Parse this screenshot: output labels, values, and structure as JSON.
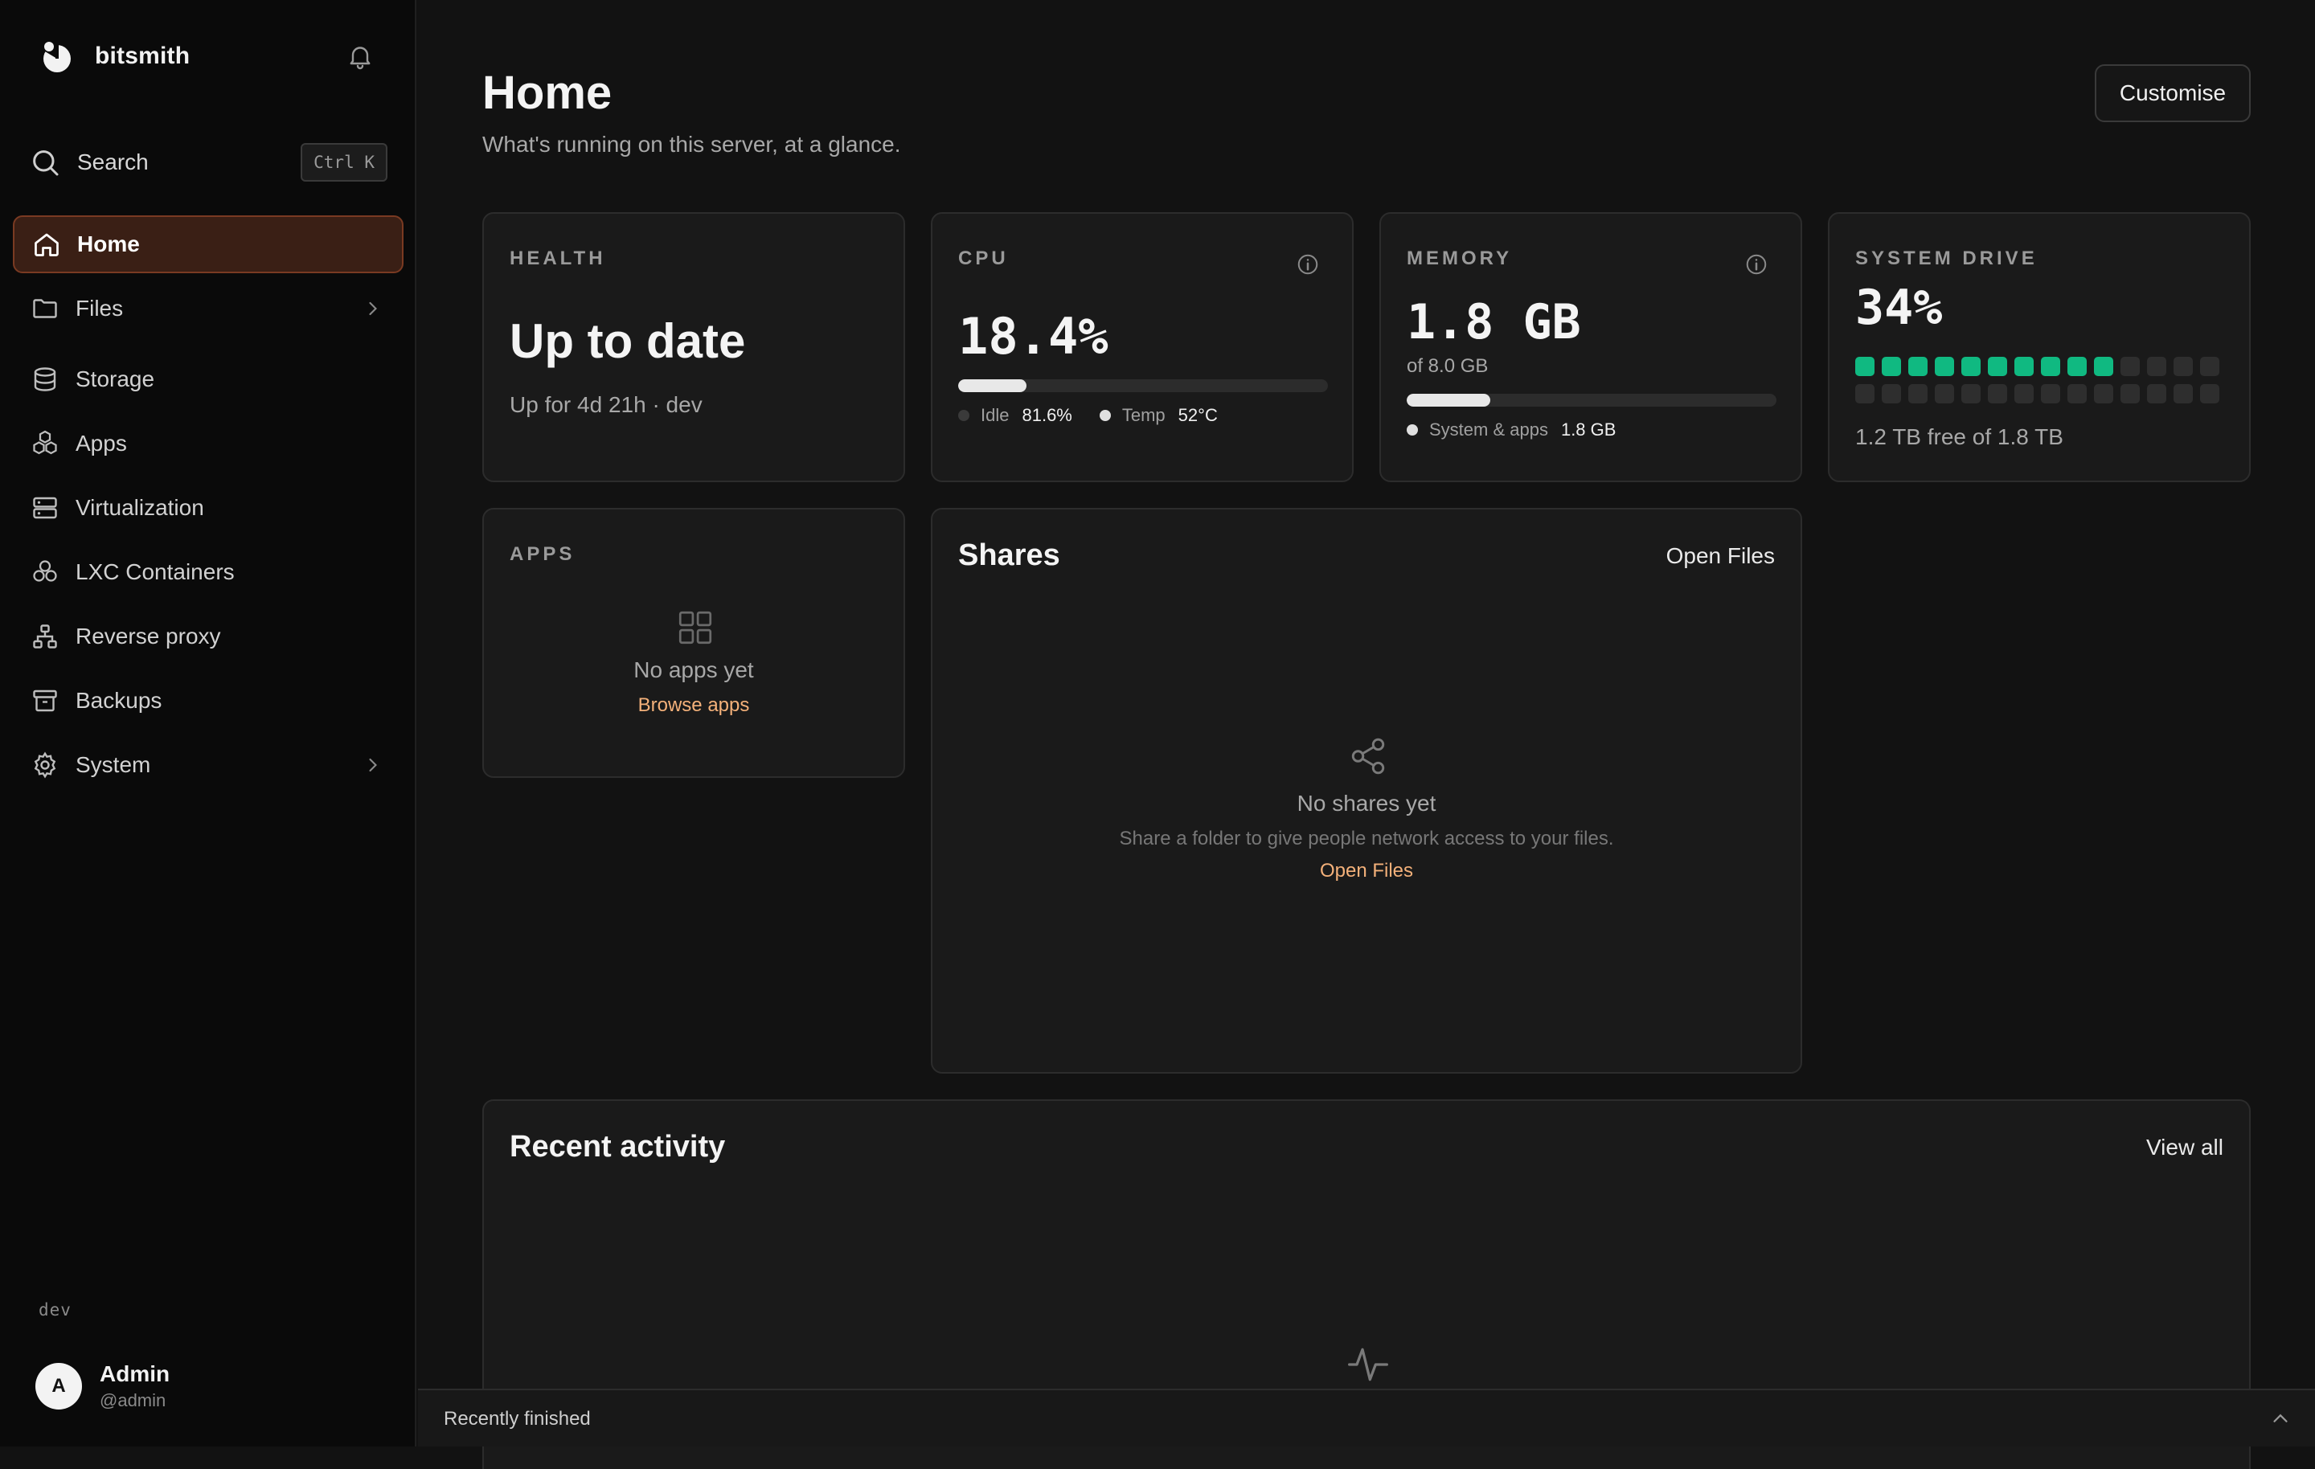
{
  "app": {
    "name": "bitsmith",
    "environment": "dev"
  },
  "search": {
    "label": "Search",
    "shortcut": "Ctrl K"
  },
  "sidebar": {
    "items": [
      {
        "label": "Home",
        "icon": "home-icon",
        "active": true
      },
      {
        "label": "Files",
        "icon": "folder-icon",
        "has_children": true
      },
      {
        "label": "Storage",
        "icon": "database-icon"
      },
      {
        "label": "Apps",
        "icon": "apps-icon"
      },
      {
        "label": "Virtualization",
        "icon": "server-icon"
      },
      {
        "label": "LXC Containers",
        "icon": "containers-icon"
      },
      {
        "label": "Reverse proxy",
        "icon": "network-icon"
      },
      {
        "label": "Backups",
        "icon": "archive-icon"
      },
      {
        "label": "System",
        "icon": "gear-icon",
        "has_children": true
      }
    ]
  },
  "user": {
    "initial": "A",
    "name": "Admin",
    "handle": "@admin"
  },
  "page": {
    "title": "Home",
    "subtitle": "What's running on this server, at a glance.",
    "customise_label": "Customise"
  },
  "health": {
    "label": "HEALTH",
    "status": "Up to date",
    "detail": "Up for 4d 21h · dev"
  },
  "cpu": {
    "label": "CPU",
    "value": "18.4%",
    "usage_fraction": 0.184,
    "idle_label": "Idle",
    "idle_value": "81.6%",
    "temp_label": "Temp",
    "temp_value": "52°C"
  },
  "memory": {
    "label": "MEMORY",
    "value": "1.8 GB",
    "total": "of 8.0 GB",
    "usage_fraction": 0.225,
    "legend_label": "System & apps",
    "legend_value": "1.8 GB"
  },
  "drive": {
    "label": "SYSTEM DRIVE",
    "value": "34%",
    "used_blocks": 10,
    "total_blocks": 28,
    "detail": "1.2 TB free of 1.8 TB",
    "colors": {
      "used": "#10b981",
      "free": "#2e2e2e"
    }
  },
  "apps_card": {
    "label": "APPS",
    "empty_text": "No apps yet",
    "link": "Browse apps"
  },
  "shares": {
    "title": "Shares",
    "header_link": "Open Files",
    "empty_title": "No shares yet",
    "empty_desc": "Share a folder to give people network access to your files.",
    "empty_link": "Open Files"
  },
  "activity": {
    "title": "Recent activity",
    "link": "View all"
  },
  "dock": {
    "label": "Recently finished"
  },
  "colors": {
    "accent": "#f4b17a",
    "active_bg": "#3a1f15",
    "active_border": "#7a3a22",
    "success": "#10b981"
  }
}
